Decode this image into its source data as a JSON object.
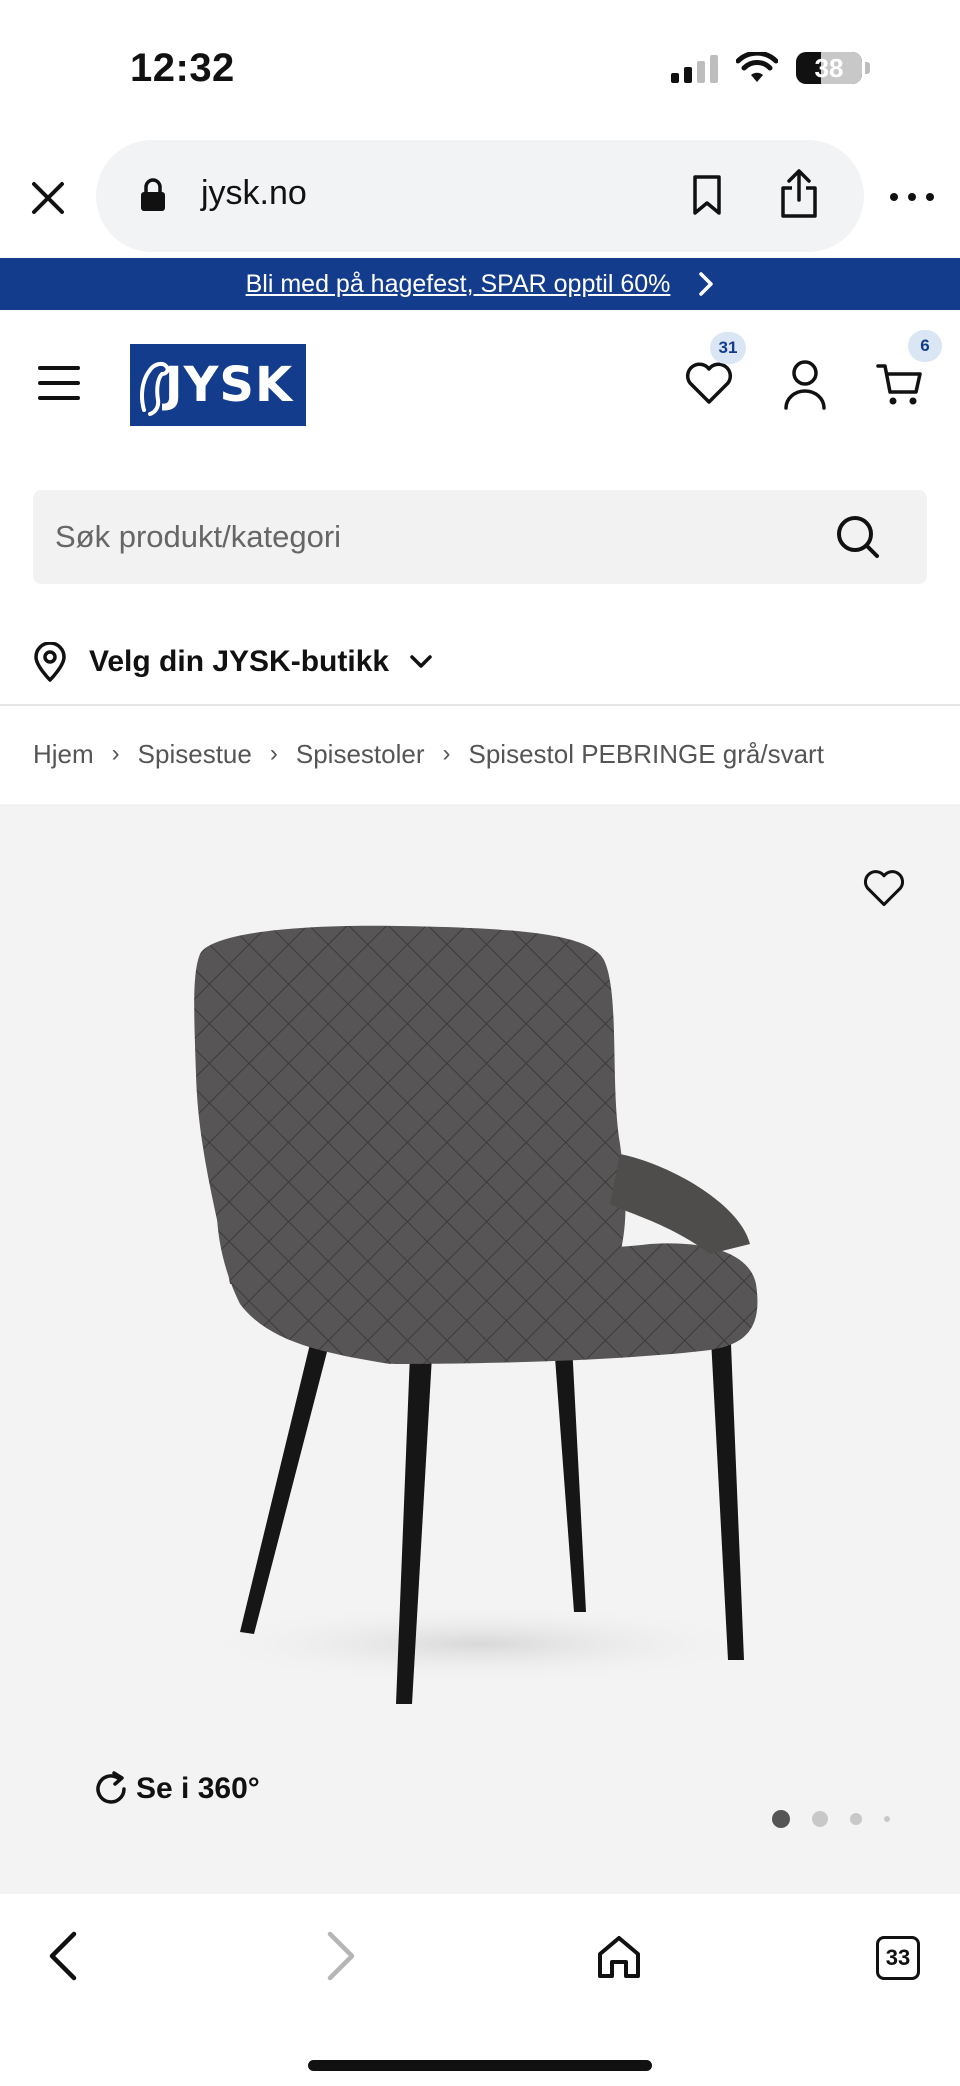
{
  "status_bar": {
    "time": "12:32",
    "battery": "38",
    "battery_level": 0.38
  },
  "browser": {
    "url": "jysk.no",
    "tabs_count": "33"
  },
  "promo": {
    "text": "Bli med på hagefest, SPAR opptil 60%"
  },
  "header": {
    "logo_text": "JYSK",
    "wishlist_count": "31",
    "cart_count": "6"
  },
  "search": {
    "placeholder": "Søk produkt/kategori"
  },
  "store": {
    "label": "Velg din JYSK-butikk"
  },
  "breadcrumb": {
    "items": [
      "Hjem",
      "Spisestue",
      "Spisestoler",
      "Spisestol PEBRINGE grå/svart"
    ]
  },
  "gallery": {
    "rotate_label": "Se i 360°",
    "image_count": 4,
    "active_index": 0
  },
  "colors": {
    "brand_blue": "#143c8c",
    "badge_bg": "#dbe6f5"
  }
}
